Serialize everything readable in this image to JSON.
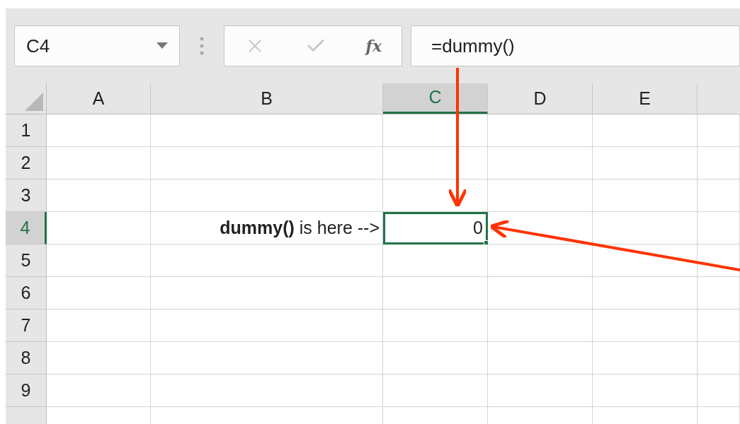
{
  "name_box": {
    "value": "C4"
  },
  "formula_bar": {
    "fx_label": "fx",
    "value": "=dummy()"
  },
  "columns": [
    {
      "label": "A",
      "selected": false
    },
    {
      "label": "B",
      "selected": false
    },
    {
      "label": "C",
      "selected": true
    },
    {
      "label": "D",
      "selected": false
    },
    {
      "label": "E",
      "selected": false
    }
  ],
  "rows": [
    {
      "header": "1",
      "selected": false
    },
    {
      "header": "2",
      "selected": false
    },
    {
      "header": "3",
      "selected": false
    },
    {
      "header": "4",
      "selected": true,
      "cells": [
        {
          "kind": "blank"
        },
        {
          "kind": "text",
          "text": "**dummy()** is here -->"
        },
        {
          "kind": "value",
          "text": "0",
          "selected": true
        }
      ]
    },
    {
      "header": "5",
      "selected": false
    },
    {
      "header": "6",
      "selected": false
    },
    {
      "header": "7",
      "selected": false
    },
    {
      "header": "8",
      "selected": false
    },
    {
      "header": "9",
      "selected": false
    }
  ]
}
